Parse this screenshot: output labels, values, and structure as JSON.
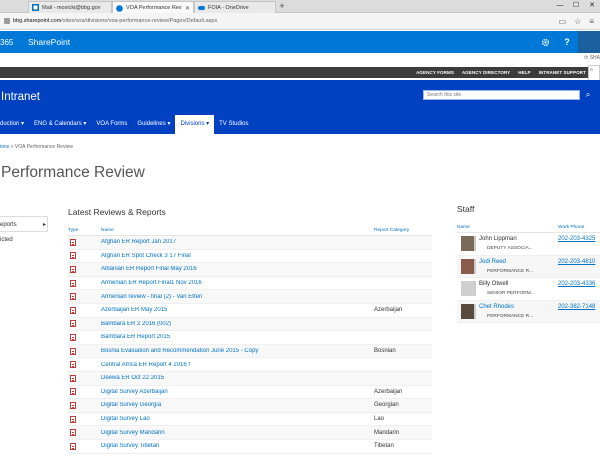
{
  "browser": {
    "tabs": [
      {
        "label": "Mail - mosicki@bbg.gov",
        "active": false
      },
      {
        "label": "VOA Performance Revie",
        "active": true
      },
      {
        "label": "FOIA - OneDrive",
        "active": false
      }
    ],
    "new_tab": "+",
    "window_controls": [
      "—",
      "☐",
      "✕"
    ],
    "url_host": "bbg.sharepoint.com",
    "url_prefix": "",
    "url_path": "/sites/voa/divisions/voa-performance-review/Pages/Default.aspx"
  },
  "suitebar": {
    "app_prefix": "365",
    "app_name": "SharePoint",
    "settings_icon": "gear-icon",
    "help_label": "?",
    "brand_color": "#0078d7"
  },
  "share": {
    "label": "SHA"
  },
  "global_links": [
    "AGENCY FORMS",
    "AGENCY DIRECTORY",
    "HELP",
    "INTRANET SUPPORT"
  ],
  "lang_box": "Ð",
  "site": {
    "title": "Intranet",
    "search_placeholder": "Search this site",
    "header_color": "#0041c2"
  },
  "topnav": [
    {
      "label": "duction ▾",
      "selected": false
    },
    {
      "label": "ENG & Calendars ▾",
      "selected": false
    },
    {
      "label": "VOA Forms",
      "selected": false
    },
    {
      "label": "Guidelines ▾",
      "selected": false
    },
    {
      "label": "Divisions ▾",
      "selected": true
    },
    {
      "label": "TV Studios",
      "selected": false
    }
  ],
  "breadcrumb": {
    "parent": "ions",
    "separator": " > ",
    "current": "VOA Performance Review"
  },
  "page_title": "Performance Review",
  "leftnav": [
    {
      "label": "eports",
      "selected": true
    },
    {
      "label": "icted",
      "selected": false
    }
  ],
  "reports": {
    "title": "Latest Reviews & Reports",
    "columns": {
      "type": "Type",
      "name": "Name",
      "category": "Report Category"
    },
    "rows": [
      {
        "name": "Afghan ER Report Jan 2017",
        "category": ""
      },
      {
        "name": "Afghan ER Spot Check 3 17 Final",
        "category": ""
      },
      {
        "name": "Albanian ER Report Final May 2016",
        "category": ""
      },
      {
        "name": "Armenian ER Report Final1 Nov 2016",
        "category": ""
      },
      {
        "name": "Armenian review - final (2) - Van Etten",
        "category": ""
      },
      {
        "name": "Azerbaijan ER May 2015",
        "category": "Azerbaijan"
      },
      {
        "name": "Bambara ER 2 2016 (002)",
        "category": ""
      },
      {
        "name": "Bambara ER Report 2015",
        "category": ""
      },
      {
        "name": "Bosnia Evaluation and Recommendation June 2015 - Copy",
        "category": "Bosnian"
      },
      {
        "name": "Central Africa ER Report 4 2016 f",
        "category": ""
      },
      {
        "name": "Deewa ER Oct 22 2015",
        "category": ""
      },
      {
        "name": "Digital Survey Azerbaijan",
        "category": "Azerbaijan"
      },
      {
        "name": "Digital Survey Georgia",
        "category": "Georgian"
      },
      {
        "name": "Digital Survey Lao",
        "category": "Lao"
      },
      {
        "name": "Digital Survey Mandarin",
        "category": "Mandarin"
      },
      {
        "name": "Digital Survey Tibetan",
        "category": "Tibetan"
      }
    ]
  },
  "staff": {
    "title": "Staff",
    "columns": {
      "name": "Name",
      "phone": "Work Phone"
    },
    "people": [
      {
        "name": "John Lippman",
        "title": "DEPUTY ASSOCIA...",
        "phone": "202-203-4325",
        "linked": false,
        "photo": "#7a6a58"
      },
      {
        "name": "Jodi Reed",
        "title": "PERFORMANCE R...",
        "phone": "202-203-4810",
        "linked": true,
        "photo": "#8a5a4a"
      },
      {
        "name": "Billy Otwell",
        "title": "SENIOR PERFORM...",
        "phone": "202-203-4336",
        "linked": false,
        "photo": "#cfcfcf"
      },
      {
        "name": "Chet Rhodes",
        "title": "PERFORMANCE R...",
        "phone": "202-382-7148",
        "linked": true,
        "photo": "#5a4a3e"
      }
    ]
  }
}
